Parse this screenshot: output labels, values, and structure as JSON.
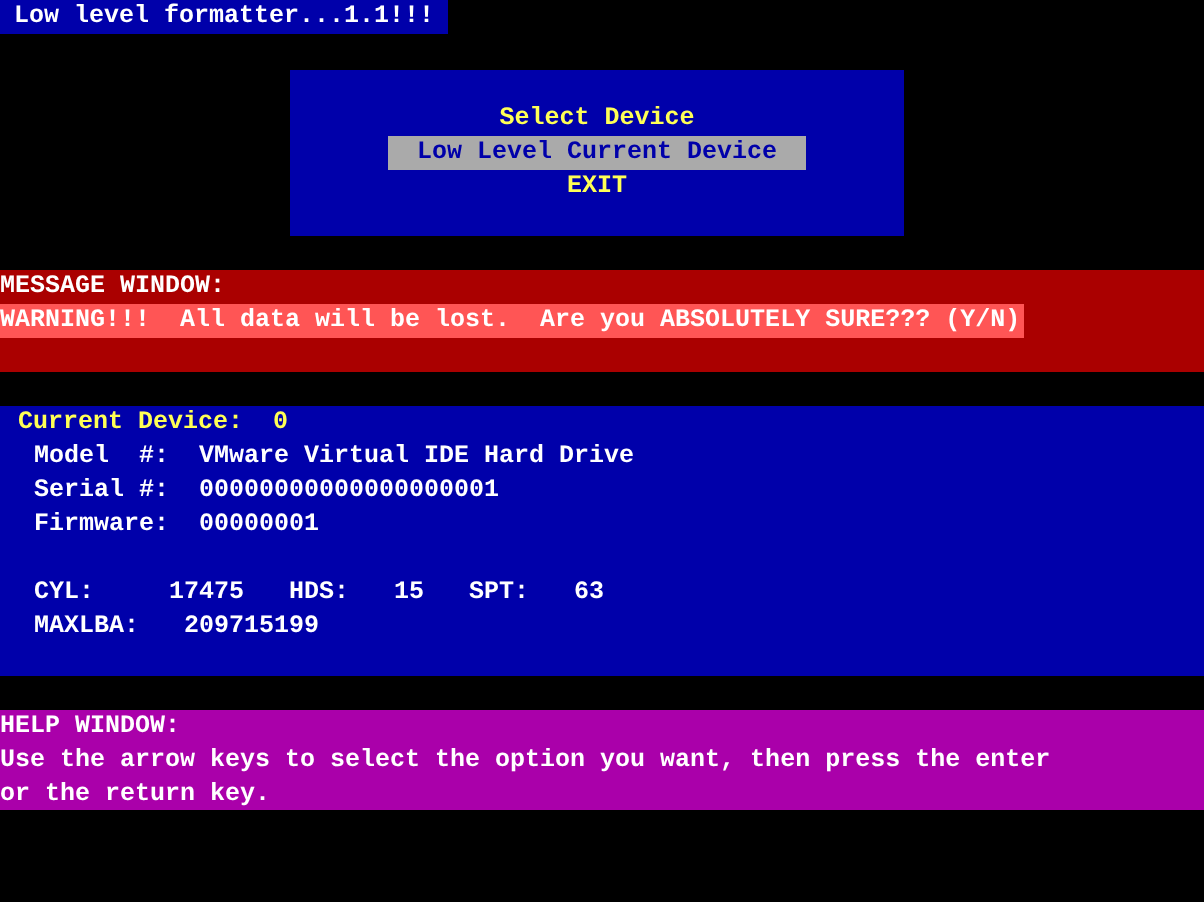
{
  "title_bar": "Low level formatter...1.1!!!",
  "menu": {
    "heading": "Select Device",
    "items": [
      {
        "label": "Low Level Current Device",
        "selected": true
      },
      {
        "label": "EXIT",
        "selected": false
      }
    ]
  },
  "message_window": {
    "heading": "MESSAGE WINDOW:",
    "text": "WARNING!!!  All data will be lost.  Are you ABSOLUTELY SURE??? (Y/N)"
  },
  "device": {
    "heading": "Current Device:",
    "number": "0",
    "fields": [
      {
        "label": "Model  #:",
        "value": "VMware Virtual IDE Hard Drive"
      },
      {
        "label": "Serial #:",
        "value": "00000000000000000001"
      },
      {
        "label": "Firmware:",
        "value": "00000001"
      }
    ],
    "geometry": [
      {
        "label": "CYL:",
        "value": "17475"
      },
      {
        "label": "HDS:",
        "value": "15"
      },
      {
        "label": "SPT:",
        "value": "63"
      }
    ],
    "maxlba": {
      "label": "MAXLBA:",
      "value": "209715199"
    }
  },
  "help_window": {
    "heading": "HELP WINDOW:",
    "text": "Use the arrow keys to select the option you want, then press the enter or the return key."
  }
}
